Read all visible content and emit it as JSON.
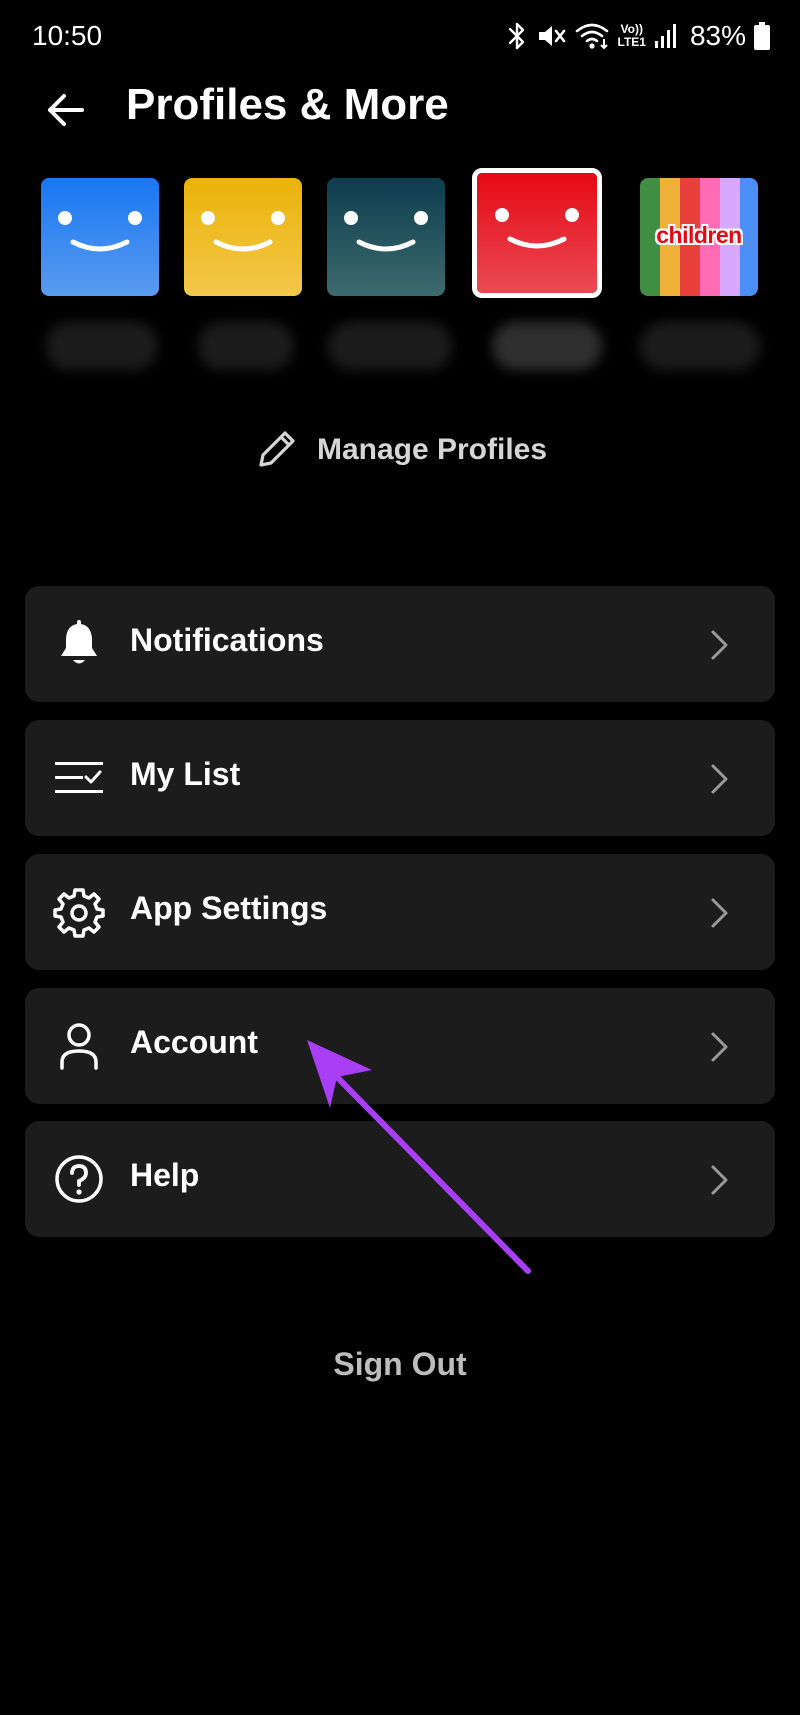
{
  "status_bar": {
    "time": "10:50",
    "battery_pct": "83%",
    "icons": [
      "bluetooth-icon",
      "mute-icon",
      "wifi-icon",
      "volte-lte-icon",
      "signal-icon",
      "battery-icon"
    ],
    "network_label_top": "Vo))",
    "network_label_bottom": "LTE1"
  },
  "header": {
    "title": "Profiles & More",
    "back_icon": "arrow-left-icon"
  },
  "profiles": [
    {
      "color_top": "#1877f2",
      "color_bottom": "#5a9bf0",
      "selected": false
    },
    {
      "color_top": "#eab308",
      "color_bottom": "#f3c74a",
      "selected": false
    },
    {
      "color_top": "#0d3d4f",
      "color_bottom": "#3d6a6d",
      "selected": false
    },
    {
      "color_top": "#e50914",
      "color_bottom": "#ea4a55",
      "selected": true
    },
    {
      "label": "children",
      "stripes": [
        "#3f8e44",
        "#f0b13b",
        "#e8403a",
        "#ff6bb4",
        "#d8a8ff",
        "#4b8ef5"
      ],
      "selected": false
    }
  ],
  "manage_profiles": {
    "label": "Manage Profiles",
    "icon": "pencil-icon"
  },
  "menu": [
    {
      "label": "Notifications",
      "icon": "bell-icon"
    },
    {
      "label": "My List",
      "icon": "list-check-icon"
    },
    {
      "label": "App Settings",
      "icon": "gear-icon"
    },
    {
      "label": "Account",
      "icon": "user-icon"
    },
    {
      "label": "Help",
      "icon": "question-circle-icon"
    }
  ],
  "sign_out": "Sign Out",
  "annotation": {
    "color": "#a93ff5",
    "icon": "annotation-arrow-icon"
  }
}
